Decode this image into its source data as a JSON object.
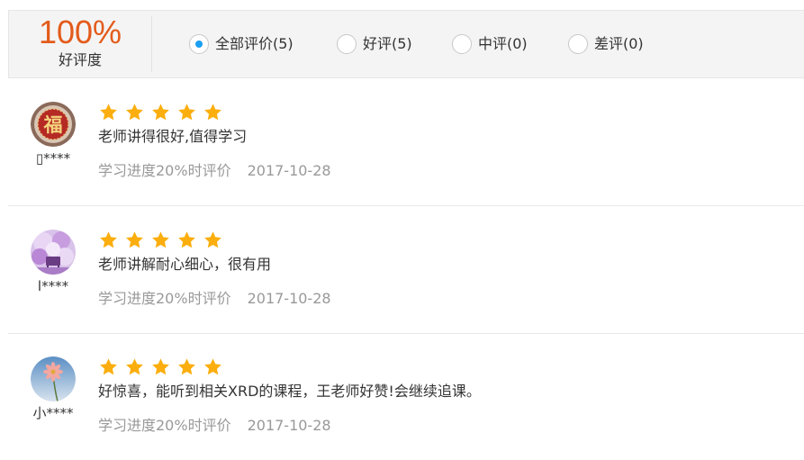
{
  "summary": {
    "rate_value": "100%",
    "rate_label": "好评度"
  },
  "filters": [
    {
      "label": "全部评价(5)",
      "checked": true
    },
    {
      "label": "好评(5)",
      "checked": false
    },
    {
      "label": "中评(0)",
      "checked": false
    },
    {
      "label": "差评(0)",
      "checked": false
    }
  ],
  "colors": {
    "accent_rate": "#e35b1b",
    "star": "#fbae0e",
    "radio_checked": "#1a9ff2",
    "muted_text": "#999999"
  },
  "reviews": [
    {
      "username": "▯****",
      "avatar_icon": "fu-character-avatar",
      "rating": 5,
      "comment": "老师讲得很好,值得学习",
      "progress": "学习进度20%时评价",
      "date": "2017-10-28"
    },
    {
      "username": "l****",
      "avatar_icon": "purple-blossom-avatar",
      "rating": 5,
      "comment": "老师讲解耐心细心，很有用",
      "progress": "学习进度20%时评价",
      "date": "2017-10-28"
    },
    {
      "username": "小****",
      "avatar_icon": "flower-sky-avatar",
      "rating": 5,
      "comment": "好惊喜，能听到相关XRD的课程，王老师好赞!会继续追课。",
      "progress": "学习进度20%时评价",
      "date": "2017-10-28"
    }
  ]
}
